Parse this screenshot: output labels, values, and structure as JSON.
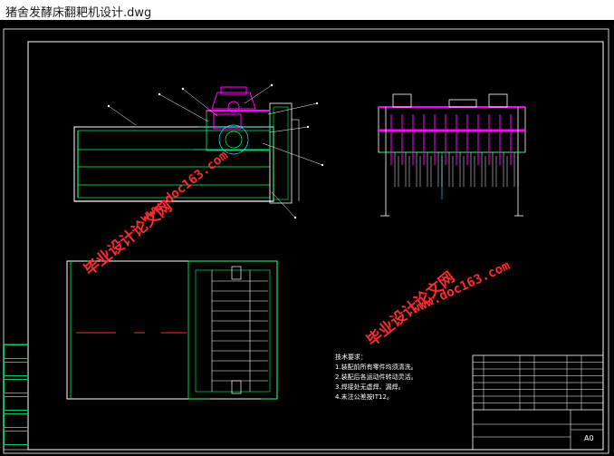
{
  "window": {
    "title": "猪舍发酵床翻耙机设计.dwg"
  },
  "watermarks": {
    "cn_text": "毕业设计论文网",
    "url_text": "www.doc163.com"
  },
  "technical_notes": {
    "heading": "技术要求：",
    "items": [
      "1.装配前所有零件均须清洗。",
      "2.装配后各运动件转动灵活。",
      "3.焊接处无虚焊、漏焊。",
      "4.未注公差按IT12。"
    ]
  },
  "left_cells": [
    "",
    "",
    "",
    "",
    "",
    ""
  ],
  "title_block": {
    "drawing_name": "",
    "sheet_size": "A0"
  },
  "colors": {
    "line_white": "#ffffff",
    "line_green": "#00ff66",
    "line_cyan": "#00ffff",
    "line_magenta": "#ff00ff",
    "line_red": "#ff2a2a",
    "watermark": "#ff2a2a"
  }
}
